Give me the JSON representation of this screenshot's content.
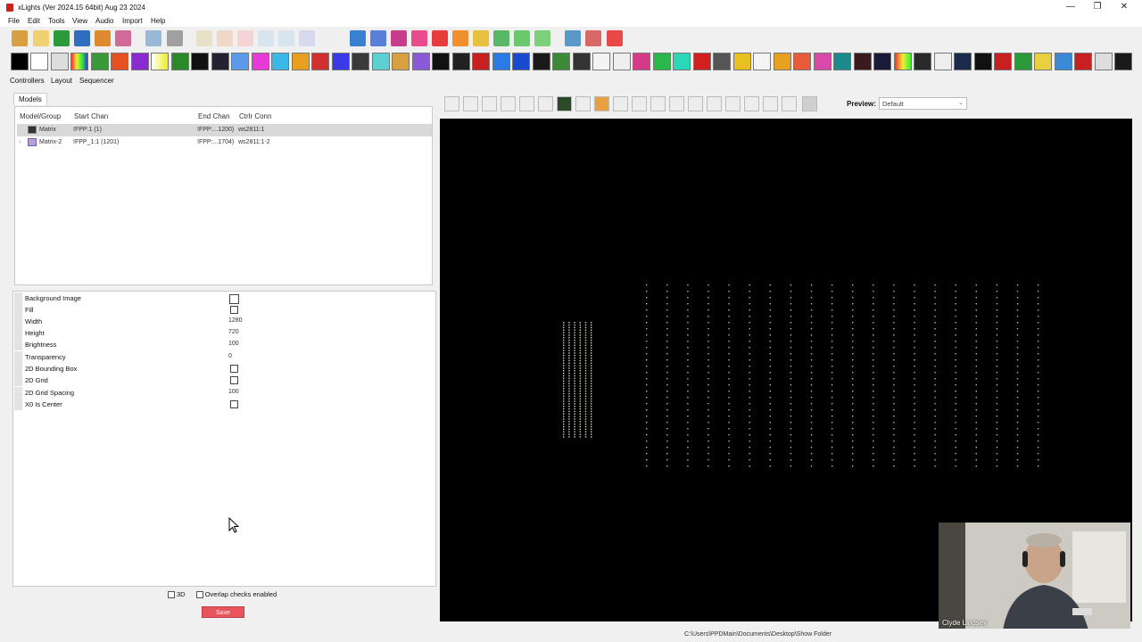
{
  "window": {
    "title": "xLights (Ver 2024.15 64bit) Aug 23 2024",
    "controls": [
      "—",
      "❐",
      "✕"
    ]
  },
  "menu": [
    "File",
    "Edit",
    "Tools",
    "View",
    "Audio",
    "Import",
    "Help"
  ],
  "tabs": [
    "Controllers",
    "Layout",
    "Sequencer"
  ],
  "models": {
    "tab_label": "Models",
    "columns": [
      "Model/Group",
      "Start Chan",
      "End Chan",
      "Ctrlr Conn"
    ],
    "rows": [
      {
        "name": "Matrix",
        "start": "!FPP:1 (1)",
        "end": "!FPP:...1200)",
        "conn": "ws2811:1"
      },
      {
        "name": "Matrix-2",
        "start": "!FPP_1:1 (1201)",
        "end": "!FPP:...1704)",
        "conn": "ws2811:1-2"
      }
    ]
  },
  "properties": [
    {
      "label": "Background Image",
      "type": "checkbox"
    },
    {
      "label": "Fill",
      "type": "checkbox"
    },
    {
      "label": "Width",
      "value": "1280"
    },
    {
      "label": "Height",
      "value": "720"
    },
    {
      "label": "Brightness",
      "value": "100"
    },
    {
      "label": "Transparency",
      "value": "0"
    },
    {
      "label": "2D Bounding Box",
      "type": "checkbox"
    },
    {
      "label": "2D Grid",
      "type": "checkbox"
    },
    {
      "label": "2D Grid Spacing",
      "value": "100"
    },
    {
      "label": "X0 Is Center",
      "type": "checkbox"
    }
  ],
  "bottom": {
    "opt_3d": "3D",
    "opt_overlap": "Overlap checks enabled",
    "save": "Save"
  },
  "preview": {
    "label": "Preview:",
    "value": "Default"
  },
  "webcam": {
    "name": "Clyde Lindsey"
  },
  "status": {
    "path": "C:\\Users\\PPDMain\\Documents\\Desktop\\Show Folder"
  },
  "colors": {
    "save_button": "#e8545c",
    "canvas": "#000000",
    "selection": "#d9d9d9"
  }
}
